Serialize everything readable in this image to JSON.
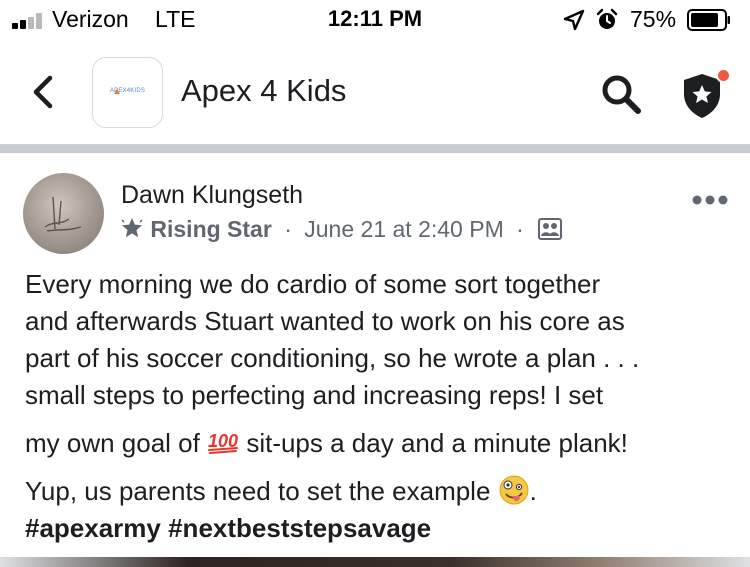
{
  "status_bar": {
    "carrier": "Verizon",
    "network": "LTE",
    "time": "12:11 PM",
    "battery_percent": "75%",
    "icons": [
      "signal-icon",
      "location-arrow-icon",
      "alarm-clock-icon",
      "battery-icon"
    ]
  },
  "header": {
    "logo_text": "APEX4KIDS",
    "title": "Apex 4 Kids",
    "icons": [
      "back-chevron-icon",
      "search-icon",
      "admin-shield-icon"
    ],
    "notification_dot_color": "#f0573d"
  },
  "post": {
    "author": "Dawn Klungseth",
    "badge": "Rising Star",
    "separator": "·",
    "date": "June 21 at 2:40 PM",
    "audience_icon": "group-members-icon",
    "more_icon": "more-horizontal-icon",
    "body_lines": [
      "Every morning we do cardio of some sort together",
      "and afterwards Stuart wanted to work on his core as",
      "part of his soccer conditioning, so he wrote a plan . . .",
      "small steps to perfecting and increasing reps!  I set"
    ],
    "line5_before": "my own goal of ",
    "emoji_100": "100",
    "line5_after": " sit-ups a day and a minute plank!",
    "line6_before": "Yup, us parents need to set the example ",
    "emoji_face": "zany-face-icon",
    "line6_after": ".",
    "hashtags": "#apexarmy #nextbeststepsavage"
  },
  "colors": {
    "text_primary": "#1c1e21",
    "text_secondary": "#616770",
    "separator_band": "#c9ccd1"
  }
}
